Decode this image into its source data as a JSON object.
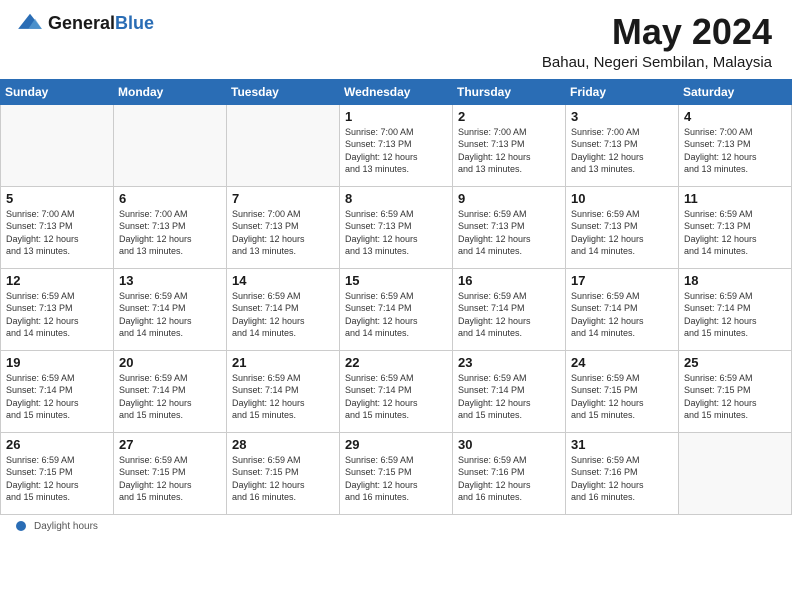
{
  "header": {
    "logo_general": "General",
    "logo_blue": "Blue",
    "month_title": "May 2024",
    "subtitle": "Bahau, Negeri Sembilan, Malaysia"
  },
  "days_of_week": [
    "Sunday",
    "Monday",
    "Tuesday",
    "Wednesday",
    "Thursday",
    "Friday",
    "Saturday"
  ],
  "weeks": [
    [
      {
        "day": "",
        "info": ""
      },
      {
        "day": "",
        "info": ""
      },
      {
        "day": "",
        "info": ""
      },
      {
        "day": "1",
        "info": "Sunrise: 7:00 AM\nSunset: 7:13 PM\nDaylight: 12 hours\nand 13 minutes."
      },
      {
        "day": "2",
        "info": "Sunrise: 7:00 AM\nSunset: 7:13 PM\nDaylight: 12 hours\nand 13 minutes."
      },
      {
        "day": "3",
        "info": "Sunrise: 7:00 AM\nSunset: 7:13 PM\nDaylight: 12 hours\nand 13 minutes."
      },
      {
        "day": "4",
        "info": "Sunrise: 7:00 AM\nSunset: 7:13 PM\nDaylight: 12 hours\nand 13 minutes."
      }
    ],
    [
      {
        "day": "5",
        "info": "Sunrise: 7:00 AM\nSunset: 7:13 PM\nDaylight: 12 hours\nand 13 minutes."
      },
      {
        "day": "6",
        "info": "Sunrise: 7:00 AM\nSunset: 7:13 PM\nDaylight: 12 hours\nand 13 minutes."
      },
      {
        "day": "7",
        "info": "Sunrise: 7:00 AM\nSunset: 7:13 PM\nDaylight: 12 hours\nand 13 minutes."
      },
      {
        "day": "8",
        "info": "Sunrise: 6:59 AM\nSunset: 7:13 PM\nDaylight: 12 hours\nand 13 minutes."
      },
      {
        "day": "9",
        "info": "Sunrise: 6:59 AM\nSunset: 7:13 PM\nDaylight: 12 hours\nand 14 minutes."
      },
      {
        "day": "10",
        "info": "Sunrise: 6:59 AM\nSunset: 7:13 PM\nDaylight: 12 hours\nand 14 minutes."
      },
      {
        "day": "11",
        "info": "Sunrise: 6:59 AM\nSunset: 7:13 PM\nDaylight: 12 hours\nand 14 minutes."
      }
    ],
    [
      {
        "day": "12",
        "info": "Sunrise: 6:59 AM\nSunset: 7:13 PM\nDaylight: 12 hours\nand 14 minutes."
      },
      {
        "day": "13",
        "info": "Sunrise: 6:59 AM\nSunset: 7:14 PM\nDaylight: 12 hours\nand 14 minutes."
      },
      {
        "day": "14",
        "info": "Sunrise: 6:59 AM\nSunset: 7:14 PM\nDaylight: 12 hours\nand 14 minutes."
      },
      {
        "day": "15",
        "info": "Sunrise: 6:59 AM\nSunset: 7:14 PM\nDaylight: 12 hours\nand 14 minutes."
      },
      {
        "day": "16",
        "info": "Sunrise: 6:59 AM\nSunset: 7:14 PM\nDaylight: 12 hours\nand 14 minutes."
      },
      {
        "day": "17",
        "info": "Sunrise: 6:59 AM\nSunset: 7:14 PM\nDaylight: 12 hours\nand 14 minutes."
      },
      {
        "day": "18",
        "info": "Sunrise: 6:59 AM\nSunset: 7:14 PM\nDaylight: 12 hours\nand 15 minutes."
      }
    ],
    [
      {
        "day": "19",
        "info": "Sunrise: 6:59 AM\nSunset: 7:14 PM\nDaylight: 12 hours\nand 15 minutes."
      },
      {
        "day": "20",
        "info": "Sunrise: 6:59 AM\nSunset: 7:14 PM\nDaylight: 12 hours\nand 15 minutes."
      },
      {
        "day": "21",
        "info": "Sunrise: 6:59 AM\nSunset: 7:14 PM\nDaylight: 12 hours\nand 15 minutes."
      },
      {
        "day": "22",
        "info": "Sunrise: 6:59 AM\nSunset: 7:14 PM\nDaylight: 12 hours\nand 15 minutes."
      },
      {
        "day": "23",
        "info": "Sunrise: 6:59 AM\nSunset: 7:14 PM\nDaylight: 12 hours\nand 15 minutes."
      },
      {
        "day": "24",
        "info": "Sunrise: 6:59 AM\nSunset: 7:15 PM\nDaylight: 12 hours\nand 15 minutes."
      },
      {
        "day": "25",
        "info": "Sunrise: 6:59 AM\nSunset: 7:15 PM\nDaylight: 12 hours\nand 15 minutes."
      }
    ],
    [
      {
        "day": "26",
        "info": "Sunrise: 6:59 AM\nSunset: 7:15 PM\nDaylight: 12 hours\nand 15 minutes."
      },
      {
        "day": "27",
        "info": "Sunrise: 6:59 AM\nSunset: 7:15 PM\nDaylight: 12 hours\nand 15 minutes."
      },
      {
        "day": "28",
        "info": "Sunrise: 6:59 AM\nSunset: 7:15 PM\nDaylight: 12 hours\nand 16 minutes."
      },
      {
        "day": "29",
        "info": "Sunrise: 6:59 AM\nSunset: 7:15 PM\nDaylight: 12 hours\nand 16 minutes."
      },
      {
        "day": "30",
        "info": "Sunrise: 6:59 AM\nSunset: 7:16 PM\nDaylight: 12 hours\nand 16 minutes."
      },
      {
        "day": "31",
        "info": "Sunrise: 6:59 AM\nSunset: 7:16 PM\nDaylight: 12 hours\nand 16 minutes."
      },
      {
        "day": "",
        "info": ""
      }
    ]
  ],
  "footer": {
    "daylight_label": "Daylight hours"
  }
}
